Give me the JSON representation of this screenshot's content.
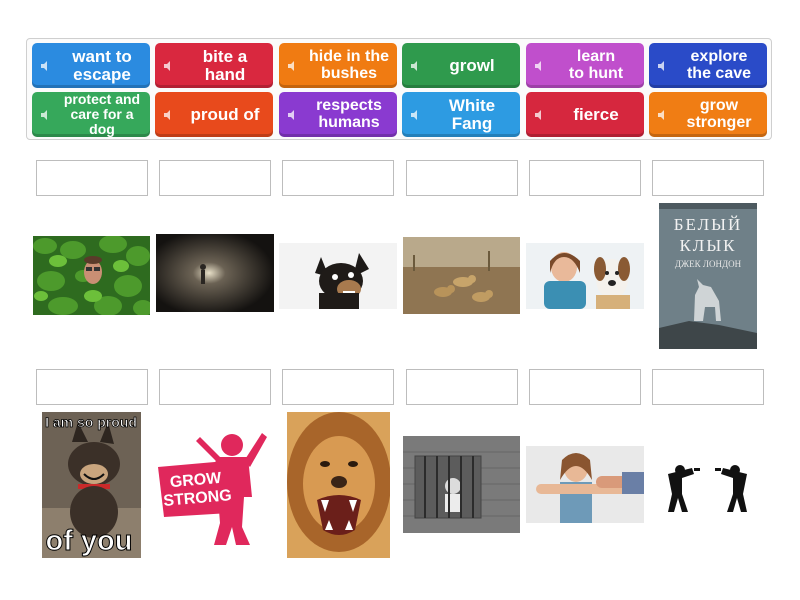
{
  "tiles": [
    {
      "label": "want to\nescape",
      "color": "#2b8be0"
    },
    {
      "label": "bite a hand",
      "color": "#d9283f"
    },
    {
      "label": "hide in the\nbushes",
      "color": "#f07b12"
    },
    {
      "label": "growl",
      "color": "#2f9a4d"
    },
    {
      "label": "learn\nto hunt",
      "color": "#c04fcc"
    },
    {
      "label": "explore\nthe cave",
      "color": "#2a4bc8"
    },
    {
      "label": "protect and\ncare for a dog",
      "color": "#36a85b"
    },
    {
      "label": "proud of",
      "color": "#e84a1c"
    },
    {
      "label": "respects\nhumans",
      "color": "#8a3ad0"
    },
    {
      "label": "White Fang",
      "color": "#2d9be2"
    },
    {
      "label": "fierce",
      "color": "#d6273e"
    },
    {
      "label": "grow\nstronger",
      "color": "#f07d14"
    }
  ],
  "images": {
    "book_title_line1": "БЕЛЫЙ",
    "book_title_line2": "КЛЫК",
    "book_author": "ДЖЕК ЛОНДОН",
    "meme_top": "I am so proud",
    "meme_bottom": "of you",
    "grow_strong_line1": "GROW",
    "grow_strong_line2": "STRONG"
  }
}
